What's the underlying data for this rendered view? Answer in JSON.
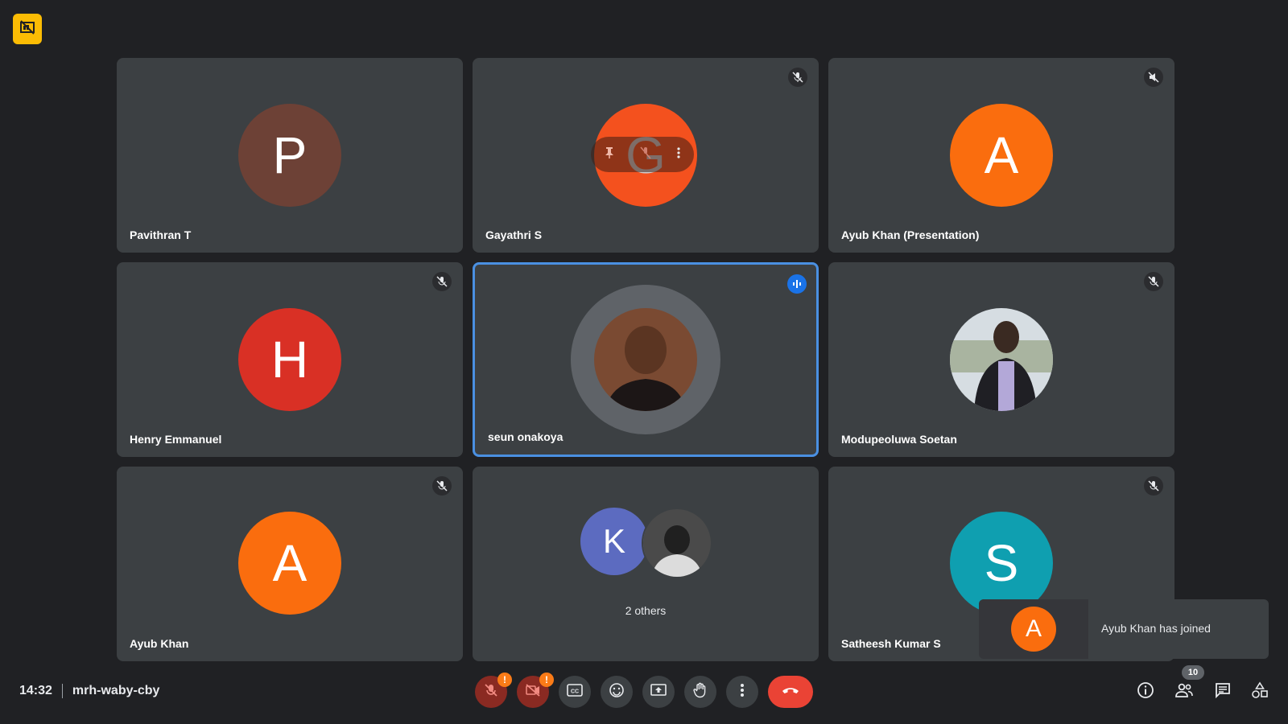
{
  "meeting": {
    "time": "14:32",
    "code": "mrh-waby-cby",
    "participant_count": "10"
  },
  "tiles": [
    {
      "name": "Pavithran T",
      "initial": "P",
      "color": "#6d4136",
      "muted": false
    },
    {
      "name": "Gayathri S",
      "initial": "G",
      "color": "#f4511e",
      "muted": true
    },
    {
      "name": "Ayub Khan (Presentation)",
      "initial": "A",
      "color": "#fa6d0e",
      "muted": true
    },
    {
      "name": "Henry Emmanuel",
      "initial": "H",
      "color": "#d93025",
      "muted": true
    },
    {
      "name": "seun onakoya",
      "initial": "",
      "color": "#5f6368",
      "muted": false,
      "speaking": true
    },
    {
      "name": "Modupeoluwa Soetan",
      "initial": "",
      "color": "#777",
      "muted": true
    },
    {
      "name": "Ayub Khan",
      "initial": "A",
      "color": "#fa6d0e",
      "muted": true
    },
    {
      "name": "",
      "initial": "K",
      "color": "#5c6bc0",
      "others_label": "2 others"
    },
    {
      "name": "Satheesh Kumar S",
      "initial": "S",
      "color": "#0f9fb0",
      "muted": true
    }
  ],
  "toast": {
    "initial": "A",
    "message": "Ayub Khan has joined",
    "color": "#fa6d0e"
  },
  "colors": {
    "background": "#202124",
    "tile": "#3c4043",
    "accent": "#1a73e8",
    "leave": "#ea4335",
    "badge": "#fbbc04"
  }
}
